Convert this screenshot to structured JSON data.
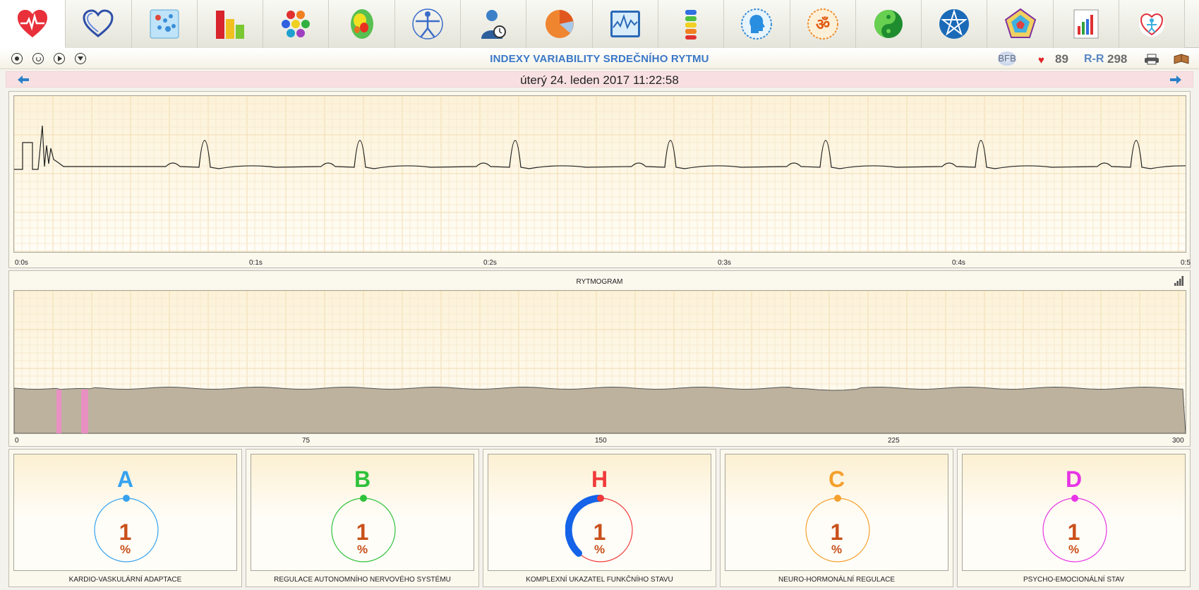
{
  "toolbar": {
    "tabs": [
      {
        "icon": "heart-ecg-icon",
        "active": true
      },
      {
        "icon": "heart-outline-icon"
      },
      {
        "icon": "bubble-grid-icon"
      },
      {
        "icon": "bar-chart-icon"
      },
      {
        "icon": "hexagon-cluster-icon"
      },
      {
        "icon": "brain-heatmap-icon"
      },
      {
        "icon": "vitruvian-man-icon"
      },
      {
        "icon": "person-clock-icon"
      },
      {
        "icon": "pie-chart-icon"
      },
      {
        "icon": "line-monitor-icon"
      },
      {
        "icon": "chakra-column-icon"
      },
      {
        "icon": "head-profile-icon"
      },
      {
        "icon": "om-symbol-icon"
      },
      {
        "icon": "yin-yang-icon"
      },
      {
        "icon": "pentagram-icon"
      },
      {
        "icon": "pentagon-radar-icon"
      },
      {
        "icon": "report-chart-icon"
      },
      {
        "icon": "heart-figure-logo-icon"
      }
    ]
  },
  "header": {
    "title": "INDEXY VARIABILITY SRDEČNÍHO RYTMU",
    "bfb": "BFB",
    "heart_rate": "89",
    "rr_label": "R-R",
    "rr_value": "298"
  },
  "datebar": {
    "date": "úterý 24. leden 2017 11:22:58"
  },
  "ecg": {
    "ticks": [
      "0:0s",
      "0:1s",
      "0:2s",
      "0:3s",
      "0:4s",
      "0:5"
    ]
  },
  "rytmogram": {
    "title": "RYTMOGRAM",
    "ticks": [
      "0",
      "75",
      "150",
      "225",
      "300"
    ]
  },
  "indicators": [
    {
      "letter": "A",
      "value": "1",
      "unit": "%",
      "label": "KARDIO-VASKULÁRNÍ ADAPTACE",
      "color": "#36a2ef"
    },
    {
      "letter": "B",
      "value": "1",
      "unit": "%",
      "label": "REGULACE AUTONOMNÍHO NERVOVÉHO SYSTÉMU",
      "color": "#2ec23a"
    },
    {
      "letter": "H",
      "value": "1",
      "unit": "%",
      "label": "KOMPLEXNÍ UKAZATEL FUNKČNÍHO STAVU",
      "color": "#f03a3a",
      "arc_color": "#1463e8"
    },
    {
      "letter": "C",
      "value": "1",
      "unit": "%",
      "label": "NEURO-HORMONÁLNÍ REGULACE",
      "color": "#f5a02e"
    },
    {
      "letter": "D",
      "value": "1",
      "unit": "%",
      "label": "PSYCHO-EMOCIONÁLNÍ STAV",
      "color": "#e634e6"
    }
  ]
}
